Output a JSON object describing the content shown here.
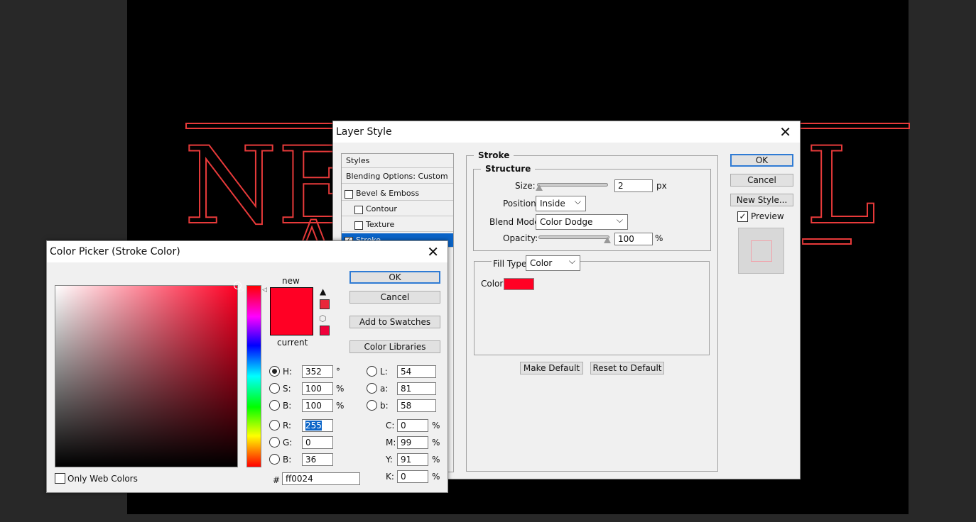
{
  "canvas": {
    "line1_left": "NE",
    "line1_right": "L",
    "line2": "AC",
    "stroke_color": "#e83a3a"
  },
  "layer_style": {
    "title": "Layer Style",
    "styles_list": [
      {
        "label": "Styles",
        "checkbox": false,
        "checked": false,
        "indent": false
      },
      {
        "label": "Blending Options: Custom",
        "checkbox": false,
        "checked": false,
        "indent": false
      },
      {
        "label": "Bevel & Emboss",
        "checkbox": true,
        "checked": false,
        "indent": false
      },
      {
        "label": "Contour",
        "checkbox": true,
        "checked": false,
        "indent": true
      },
      {
        "label": "Texture",
        "checkbox": true,
        "checked": false,
        "indent": true
      },
      {
        "label": "Stroke",
        "checkbox": true,
        "checked": true,
        "indent": false,
        "selected": true
      }
    ],
    "stroke": {
      "legend": "Stroke",
      "structure_legend": "Structure",
      "size_label": "Size:",
      "size_value": "2",
      "size_unit": "px",
      "position_label": "Position:",
      "position_value": "Inside",
      "blend_label": "Blend Mode:",
      "blend_value": "Color Dodge",
      "opacity_label": "Opacity:",
      "opacity_value": "100",
      "opacity_unit": "%",
      "fill_type_label": "Fill Type:",
      "fill_type_value": "Color",
      "color_label": "Color:",
      "color": "#ff0024"
    },
    "make_default": "Make Default",
    "reset_default": "Reset to Default",
    "ok": "OK",
    "cancel": "Cancel",
    "new_style": "New Style...",
    "preview_label": "Preview",
    "preview_checked": true
  },
  "color_picker": {
    "title": "Color Picker (Stroke Color)",
    "new_label": "new",
    "current_label": "current",
    "new_color": "#ff0024",
    "current_color": "#ff0024",
    "ok": "OK",
    "cancel": "Cancel",
    "add_swatches": "Add to Swatches",
    "color_libraries": "Color Libraries",
    "hsb": [
      {
        "label": "H:",
        "value": "352",
        "unit": "°",
        "selected": true
      },
      {
        "label": "S:",
        "value": "100",
        "unit": "%"
      },
      {
        "label": "B:",
        "value": "100",
        "unit": "%"
      }
    ],
    "rgb": [
      {
        "label": "R:",
        "value": "255"
      },
      {
        "label": "G:",
        "value": "0"
      },
      {
        "label": "B:",
        "value": "36"
      }
    ],
    "lab": [
      {
        "label": "L:",
        "value": "54"
      },
      {
        "label": "a:",
        "value": "81"
      },
      {
        "label": "b:",
        "value": "58"
      }
    ],
    "cmyk": [
      {
        "label": "C:",
        "value": "0",
        "unit": "%"
      },
      {
        "label": "M:",
        "value": "99",
        "unit": "%"
      },
      {
        "label": "Y:",
        "value": "91",
        "unit": "%"
      },
      {
        "label": "K:",
        "value": "0",
        "unit": "%"
      }
    ],
    "hex_label": "#",
    "hex": "ff0024",
    "only_web_label": "Only Web Colors",
    "only_web_checked": false,
    "hue_color": "#ff0024"
  }
}
